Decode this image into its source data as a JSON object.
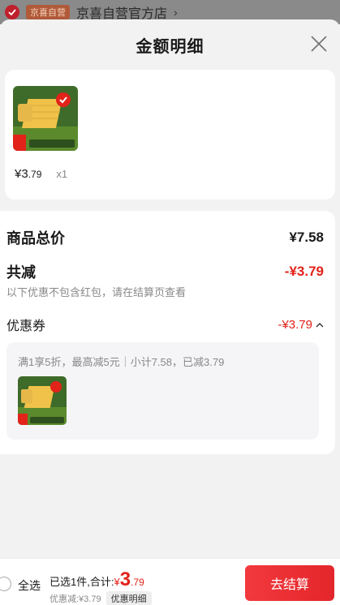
{
  "store": {
    "tag": "京喜自营",
    "name": "京喜自营官方店",
    "chevron": "›"
  },
  "sheet": {
    "title": "金额明细",
    "close_icon": "close-icon"
  },
  "product": {
    "price_int": "¥3",
    "price_dec": ".79",
    "quantity": "x1",
    "image_icon": "product-mat-image"
  },
  "summary": {
    "total_label": "商品总价",
    "total_value": "¥7.58",
    "discount_label": "共减",
    "discount_value": "-¥3.79",
    "discount_note": "以下优惠不包含红包，请在结算页查看",
    "coupon_label": "优惠券",
    "coupon_value": "-¥3.79",
    "coupon_chevron": "chevron-up-icon",
    "coupon_desc": "满1享5折，最高减5元｜小计7.58，已减3.79"
  },
  "footer": {
    "select_all": "全选",
    "selected_text": "已选1件,合计:",
    "total_sym": "¥",
    "total_int": "3",
    "total_dec": ".79",
    "discount_text": "优惠减:¥3.79",
    "detail_label": "优惠明细",
    "checkout_label": "去结算"
  },
  "colors": {
    "accent_red": "#e2231a",
    "button_red": "#f2393d",
    "product_yellow": "#f0c24a",
    "product_green": "#3f6b2a"
  }
}
